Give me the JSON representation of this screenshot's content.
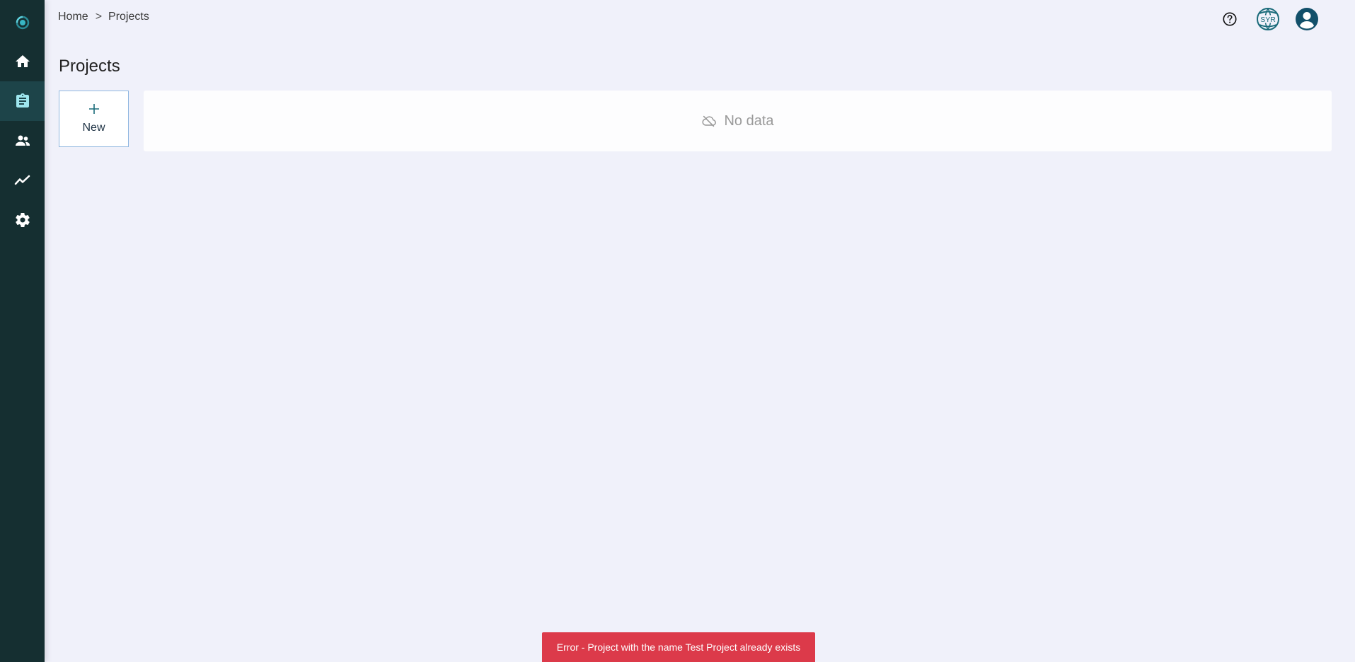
{
  "sidebar": {
    "items": [
      {
        "name": "home",
        "icon": "home-icon"
      },
      {
        "name": "projects",
        "icon": "clipboard-icon",
        "active": true
      },
      {
        "name": "users",
        "icon": "people-icon"
      },
      {
        "name": "analytics",
        "icon": "trend-line-icon"
      },
      {
        "name": "settings",
        "icon": "gear-icon"
      }
    ],
    "colors": {
      "background": "#152f31",
      "active": "#1d4449",
      "icon": "#ffffff",
      "active_icon": "#9ee6ee"
    }
  },
  "breadcrumb": {
    "items": [
      "Home",
      "Projects"
    ],
    "separator": ">"
  },
  "header": {
    "title": "Projects",
    "language_badge": "SYR",
    "icons": [
      "help-circle-icon",
      "globe-language-icon",
      "user-account-icon"
    ]
  },
  "new_card": {
    "label": "New"
  },
  "empty_state": {
    "message": "No data",
    "icon": "cloud-off-icon"
  },
  "toast": {
    "message": "Error - Project with the name Test Project already exists",
    "color": "#dc3a4a"
  },
  "colors": {
    "page_background": "#f0f1fa",
    "accent_teal": "#1a6b7a"
  }
}
